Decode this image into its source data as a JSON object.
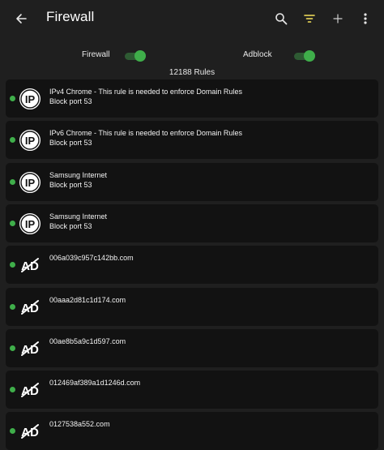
{
  "appbar": {
    "title": "Firewall",
    "back_icon": "arrow-back-icon",
    "actions": [
      "search-icon",
      "filter-icon",
      "add-icon",
      "more-vert-icon"
    ],
    "filter_color": "#f5e25b"
  },
  "toggles": {
    "firewall_label": "Firewall",
    "firewall_on": true,
    "adblock_label": "Adblock",
    "adblock_on": true
  },
  "rules_count": "12188 Rules",
  "accent": "#3fae4a",
  "rules": [
    {
      "type": "ip",
      "title": "IPv4 Chrome - This rule is needed to enforce Domain Rules",
      "detail": "Block port 53"
    },
    {
      "type": "ip",
      "title": "IPv6 Chrome - This rule is needed to enforce Domain Rules",
      "detail": "Block port 53"
    },
    {
      "type": "ip",
      "title": "Samsung Internet",
      "detail": "Block port 53"
    },
    {
      "type": "ip",
      "title": "Samsung Internet",
      "detail": "Block port 53"
    },
    {
      "type": "ad",
      "title": "006a039c957c142bb.com",
      "detail": ""
    },
    {
      "type": "ad",
      "title": "00aaa2d81c1d174.com",
      "detail": ""
    },
    {
      "type": "ad",
      "title": "00ae8b5a9c1d597.com",
      "detail": ""
    },
    {
      "type": "ad",
      "title": "012469af389a1d1246d.com",
      "detail": ""
    },
    {
      "type": "ad",
      "title": "0127538a552.com",
      "detail": ""
    }
  ]
}
